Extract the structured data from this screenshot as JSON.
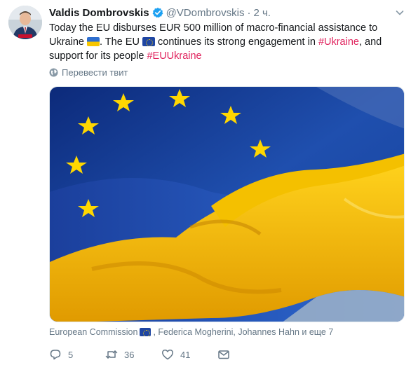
{
  "tweet": {
    "author_name": "Valdis Dombrovskis",
    "handle": "@VDombrovskis",
    "separator": "·",
    "time": "2 ч.",
    "text": {
      "part1": "Today the EU disburses EUR 500 million of macro-financial assistance to Ukraine ",
      "part2": ". The EU ",
      "part3": " continues its strong  engagement in ",
      "hashtag1": "#Ukraine",
      "part4": ", and support for its people ",
      "hashtag2": "#EUUkraine"
    },
    "translate_label": "Перевести твит",
    "tagged": {
      "first": "European Commission",
      "rest": ", Federica Mogherini, Johannes Hahn и еще 7"
    },
    "actions": {
      "replies": "5",
      "retweets": "36",
      "likes": "41"
    }
  },
  "icons": {
    "verified": "verified-badge-icon",
    "caret": "chevron-down-icon",
    "globe": "globe-icon",
    "reply": "reply-icon",
    "retweet": "retweet-icon",
    "like": "heart-icon",
    "dm": "mail-icon"
  },
  "colors": {
    "hashtag": "#e0245e",
    "secondary_text": "#657786",
    "verified": "#1da1f2",
    "flag_blue": "#1f46a3",
    "flag_yellow": "#f7c600"
  }
}
